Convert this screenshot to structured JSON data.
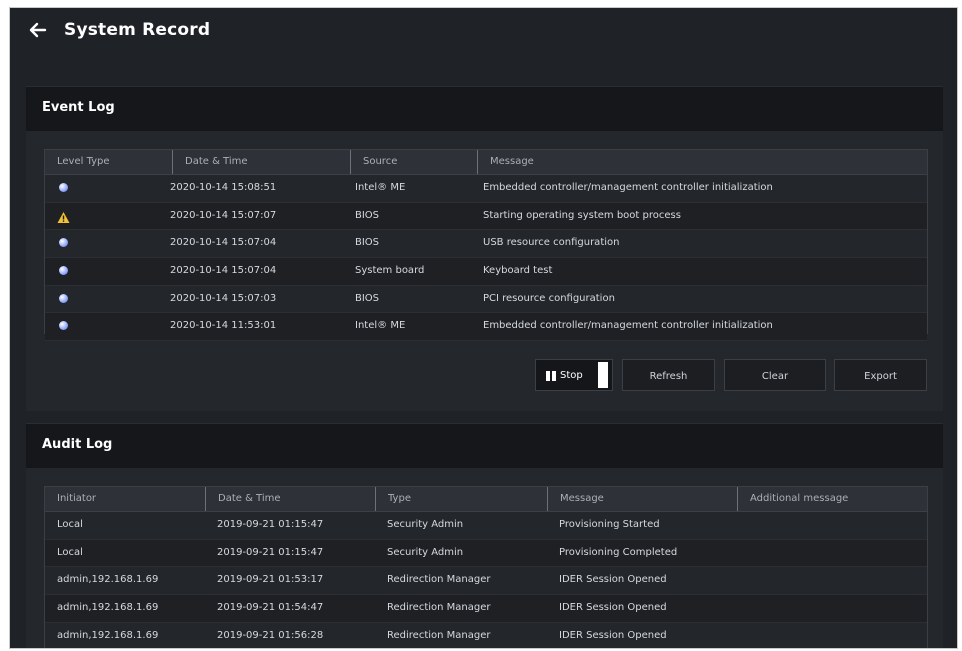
{
  "header": {
    "title": "System Record"
  },
  "event_log": {
    "title": "Event Log",
    "columns": [
      "Level Type",
      "Date & Time",
      "Source",
      "Message"
    ],
    "rows": [
      {
        "level": "info",
        "datetime": "2020-10-14 15:08:51",
        "source": "Intel® ME",
        "message": "Embedded controller/management controller initialization"
      },
      {
        "level": "warning",
        "datetime": "2020-10-14 15:07:07",
        "source": "BIOS",
        "message": "Starting operating system boot process"
      },
      {
        "level": "info",
        "datetime": "2020-10-14 15:07:04",
        "source": "BIOS",
        "message": "USB resource configuration"
      },
      {
        "level": "info",
        "datetime": "2020-10-14 15:07:04",
        "source": "System board",
        "message": "Keyboard test"
      },
      {
        "level": "info",
        "datetime": "2020-10-14 15:07:03",
        "source": "BIOS",
        "message": "PCI resource configuration"
      },
      {
        "level": "info",
        "datetime": "2020-10-14 11:53:01",
        "source": "Intel® ME",
        "message": "Embedded controller/management controller initialization"
      }
    ],
    "buttons": {
      "stop": "Stop",
      "refresh": "Refresh",
      "clear": "Clear",
      "export": "Export"
    }
  },
  "audit_log": {
    "title": "Audit Log",
    "columns": [
      "Initiator",
      "Date & Time",
      "Type",
      "Message",
      "Additional message"
    ],
    "rows": [
      {
        "initiator": "Local",
        "datetime": "2019-09-21 01:15:47",
        "type": "Security Admin",
        "message": "Provisioning Started",
        "additional": ""
      },
      {
        "initiator": "Local",
        "datetime": "2019-09-21 01:15:47",
        "type": "Security Admin",
        "message": "Provisioning Completed",
        "additional": ""
      },
      {
        "initiator": "admin,192.168.1.69",
        "datetime": "2019-09-21 01:53:17",
        "type": "Redirection Manager",
        "message": "IDER Session Opened",
        "additional": ""
      },
      {
        "initiator": "admin,192.168.1.69",
        "datetime": "2019-09-21 01:54:47",
        "type": "Redirection Manager",
        "message": "IDER Session Opened",
        "additional": ""
      },
      {
        "initiator": "admin,192.168.1.69",
        "datetime": "2019-09-21 01:56:28",
        "type": "Redirection Manager",
        "message": "IDER Session Opened",
        "additional": ""
      }
    ]
  },
  "colors": {
    "background": "#1f2227",
    "header_band": "#15171b",
    "info_dot": "#8fa6ff",
    "warning": "#f2c230"
  },
  "icons": {
    "back": "arrow-left-icon",
    "info": "info-dot-icon",
    "warning": "warning-triangle-icon",
    "pause": "pause-icon"
  }
}
